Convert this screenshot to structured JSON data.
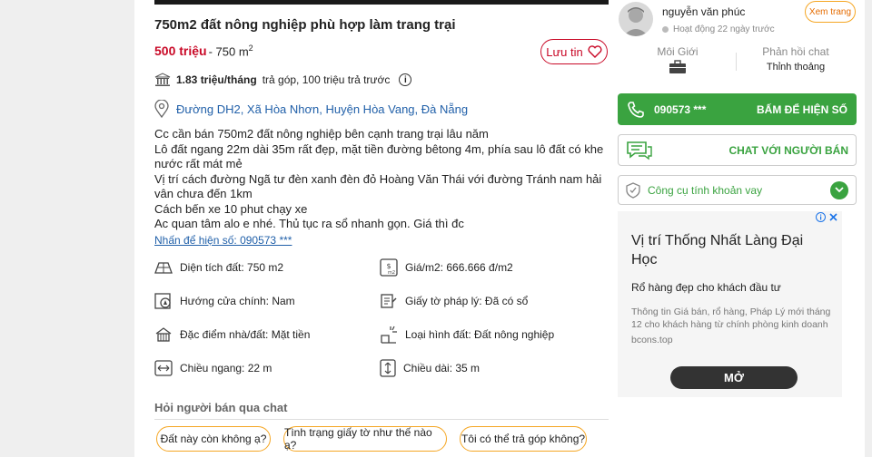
{
  "listing": {
    "title": "750m2 đất nông nghiệp phù hợp làm trang trại",
    "price": "500 triệu",
    "area_prefix": "- 750 m",
    "area_sup": "2",
    "save_label": "Lưu tin",
    "loan_amount": "1.83 triệu/tháng",
    "loan_text": "trả góp, 100 triệu trả trước",
    "address": "Đường DH2, Xã Hòa Nhơn, Huyện Hòa Vang, Đà Nẵng",
    "description": [
      "Cc cần bán 750m2 đất nông nghiệp bên cạnh trang trại lâu năm",
      "Lô đất ngang 22m dài 35m rất đẹp, mặt tiền đường bêtong 4m, phía sau lô đất có khe nước rất mát mẻ",
      "Vị trí cách đường Ngã tư đèn xanh đèn đỏ Hoàng Văn Thái với đường Tránh nam hải vân chưa đến 1km",
      "Cách bến xe 10 phut chạy xe",
      "Ac quan tâm alo e nhé. Thủ tục ra sổ nhanh gọn. Giá thì đc"
    ],
    "phone_link": "Nhấn để hiện số: 090573 ***",
    "specs": [
      {
        "label": "Diện tích đất: 750 m2",
        "icon": "area-icon"
      },
      {
        "label": "Giá/m2: 666.666 đ/m2",
        "icon": "price-per-m2-icon"
      },
      {
        "label": "Hướng cửa chính: Nam",
        "icon": "compass-icon"
      },
      {
        "label": "Giấy tờ pháp lý: Đã có sổ",
        "icon": "document-icon"
      },
      {
        "label": "Đặc điểm nhà/đất: Mặt tiền",
        "icon": "house-icon"
      },
      {
        "label": "Loại hình đất: Đất nông nghiệp",
        "icon": "land-icon"
      },
      {
        "label": "Chiều ngang: 22 m",
        "icon": "width-icon"
      },
      {
        "label": "Chiều dài: 35 m",
        "icon": "length-icon"
      }
    ],
    "ask_title": "Hỏi người bán qua chat",
    "questions": [
      "Đất này còn không ạ?",
      "Tình trạng giấy tờ như thế nào ạ?",
      "Tôi có thể trả góp không?"
    ]
  },
  "seller": {
    "name": "nguyễn văn phúc",
    "status": "Hoạt động 22 ngày trước",
    "profile_label": "Xem trang",
    "stat1_label": "Môi Giới",
    "stat2_label": "Phản hồi chat",
    "stat2_value": "Thỉnh thoảng",
    "phone": "090573 ***",
    "show_label": "BẤM ĐỂ HIỆN SỐ",
    "chat_label": "CHAT VỚI NGƯỜI BÁN",
    "loan_tool_label": "Công cụ tính khoản vay"
  },
  "ad": {
    "title": "Vị trí Thống Nhất Làng Đại Học",
    "subtitle": "Rổ hàng đẹp cho khách đầu tư",
    "body": "Thông tin Giá bán, rổ hàng, Pháp Lý mới tháng 12 cho khách hàng từ chính phòng kinh doanh",
    "domain": "bcons.top",
    "cta": "MỞ"
  },
  "colors": {
    "accent_red": "#c90927",
    "green": "#3aa340",
    "link_blue": "#2160a9",
    "orange": "#f5a623"
  }
}
